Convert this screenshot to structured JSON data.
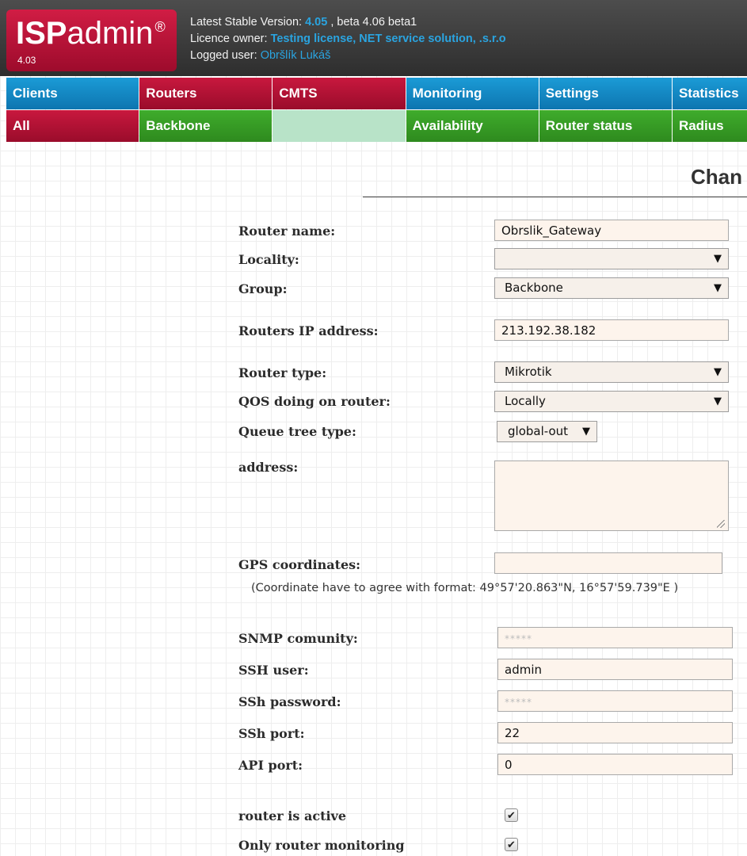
{
  "app": {
    "logo_brand_bold": "ISP",
    "logo_brand_rest": "admin",
    "logo_reg": "®",
    "logo_version": "4.03"
  },
  "header": {
    "stable_label": "Latest Stable Version: ",
    "stable_version": "4.05",
    "beta_text": " , beta 4.06 beta1",
    "licence_label": "Licence owner: ",
    "licence_owner": "Testing license, NET service solution, .s.r.o",
    "user_label": "Logged user: ",
    "user_name": "Obršlík Lukáš"
  },
  "nav": {
    "main": [
      {
        "label": "Clients"
      },
      {
        "label": "Routers"
      },
      {
        "label": "CMTS"
      },
      {
        "label": "Monitoring"
      },
      {
        "label": "Settings"
      },
      {
        "label": "Statistics"
      }
    ],
    "sub": [
      {
        "label": "All"
      },
      {
        "label": "Backbone"
      },
      {
        "label": ""
      },
      {
        "label": "Availability"
      },
      {
        "label": "Router status"
      },
      {
        "label": "Radius"
      }
    ]
  },
  "page": {
    "title": "Chan"
  },
  "form": {
    "router_name": {
      "label": "Router name:",
      "value": "Obrslik_Gateway"
    },
    "locality": {
      "label": "Locality:",
      "value": ""
    },
    "group": {
      "label": "Group:",
      "value": "Backbone"
    },
    "ip": {
      "label": "Routers IP address:",
      "value": "213.192.38.182"
    },
    "router_type": {
      "label": "Router type:",
      "value": "Mikrotik"
    },
    "qos": {
      "label": "QOS doing on router:",
      "value": "Locally"
    },
    "queue_tree": {
      "label": "Queue tree type:",
      "value": "global-out"
    },
    "address": {
      "label": "address:",
      "value": ""
    },
    "gps": {
      "label": "GPS coordinates:",
      "value": "",
      "hint": "(Coordinate have to agree with format: 49°57'20.863\"N, 16°57'59.739\"E )"
    },
    "snmp": {
      "label": "SNMP comunity:",
      "placeholder": "*****"
    },
    "ssh_user": {
      "label": "SSH user:",
      "value": "admin"
    },
    "ssh_password": {
      "label": "SSh password:",
      "placeholder": "*****"
    },
    "ssh_port": {
      "label": "SSh port:",
      "value": "22"
    },
    "api_port": {
      "label": "API port:",
      "value": "0"
    },
    "router_active": {
      "label": "router is active",
      "checked": true
    },
    "only_monitoring": {
      "label": "Only router monitoring",
      "checked": true
    }
  },
  "icons": {
    "dropdown": "▼",
    "check": "✔"
  }
}
